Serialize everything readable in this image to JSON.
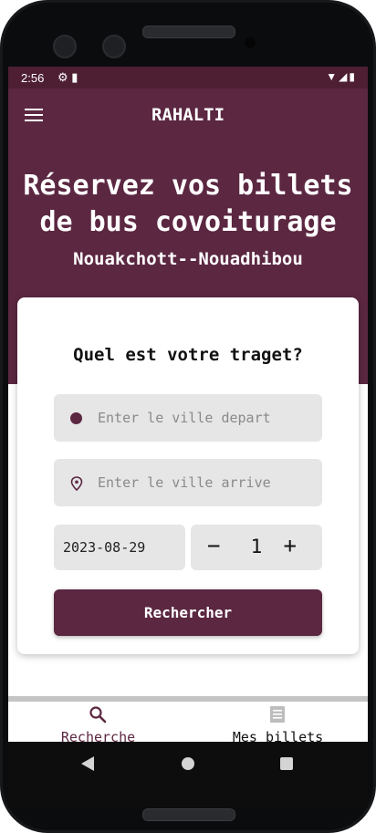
{
  "status_bar": {
    "time": "2:56"
  },
  "app_bar": {
    "title": "RAHALTI"
  },
  "hero": {
    "headline_line1": "Réservez vos billets",
    "headline_line2": "de bus covoiturage",
    "route": "Nouakchott--Nouadhibou"
  },
  "form": {
    "title": "Quel est votre traget?",
    "departure_placeholder": "Enter le ville depart",
    "arrival_placeholder": "Enter le ville arrive",
    "date": "2023-08-29",
    "quantity": "1",
    "minus": "−",
    "plus": "+",
    "search_label": "Rechercher"
  },
  "bottom_nav": {
    "items": [
      {
        "label": "Recherche",
        "icon": "search-icon",
        "active": true
      },
      {
        "label": "Mes billets",
        "icon": "tickets-icon",
        "active": false
      }
    ]
  },
  "colors": {
    "primary": "#5b2741",
    "status_bar": "#4e1f33"
  }
}
